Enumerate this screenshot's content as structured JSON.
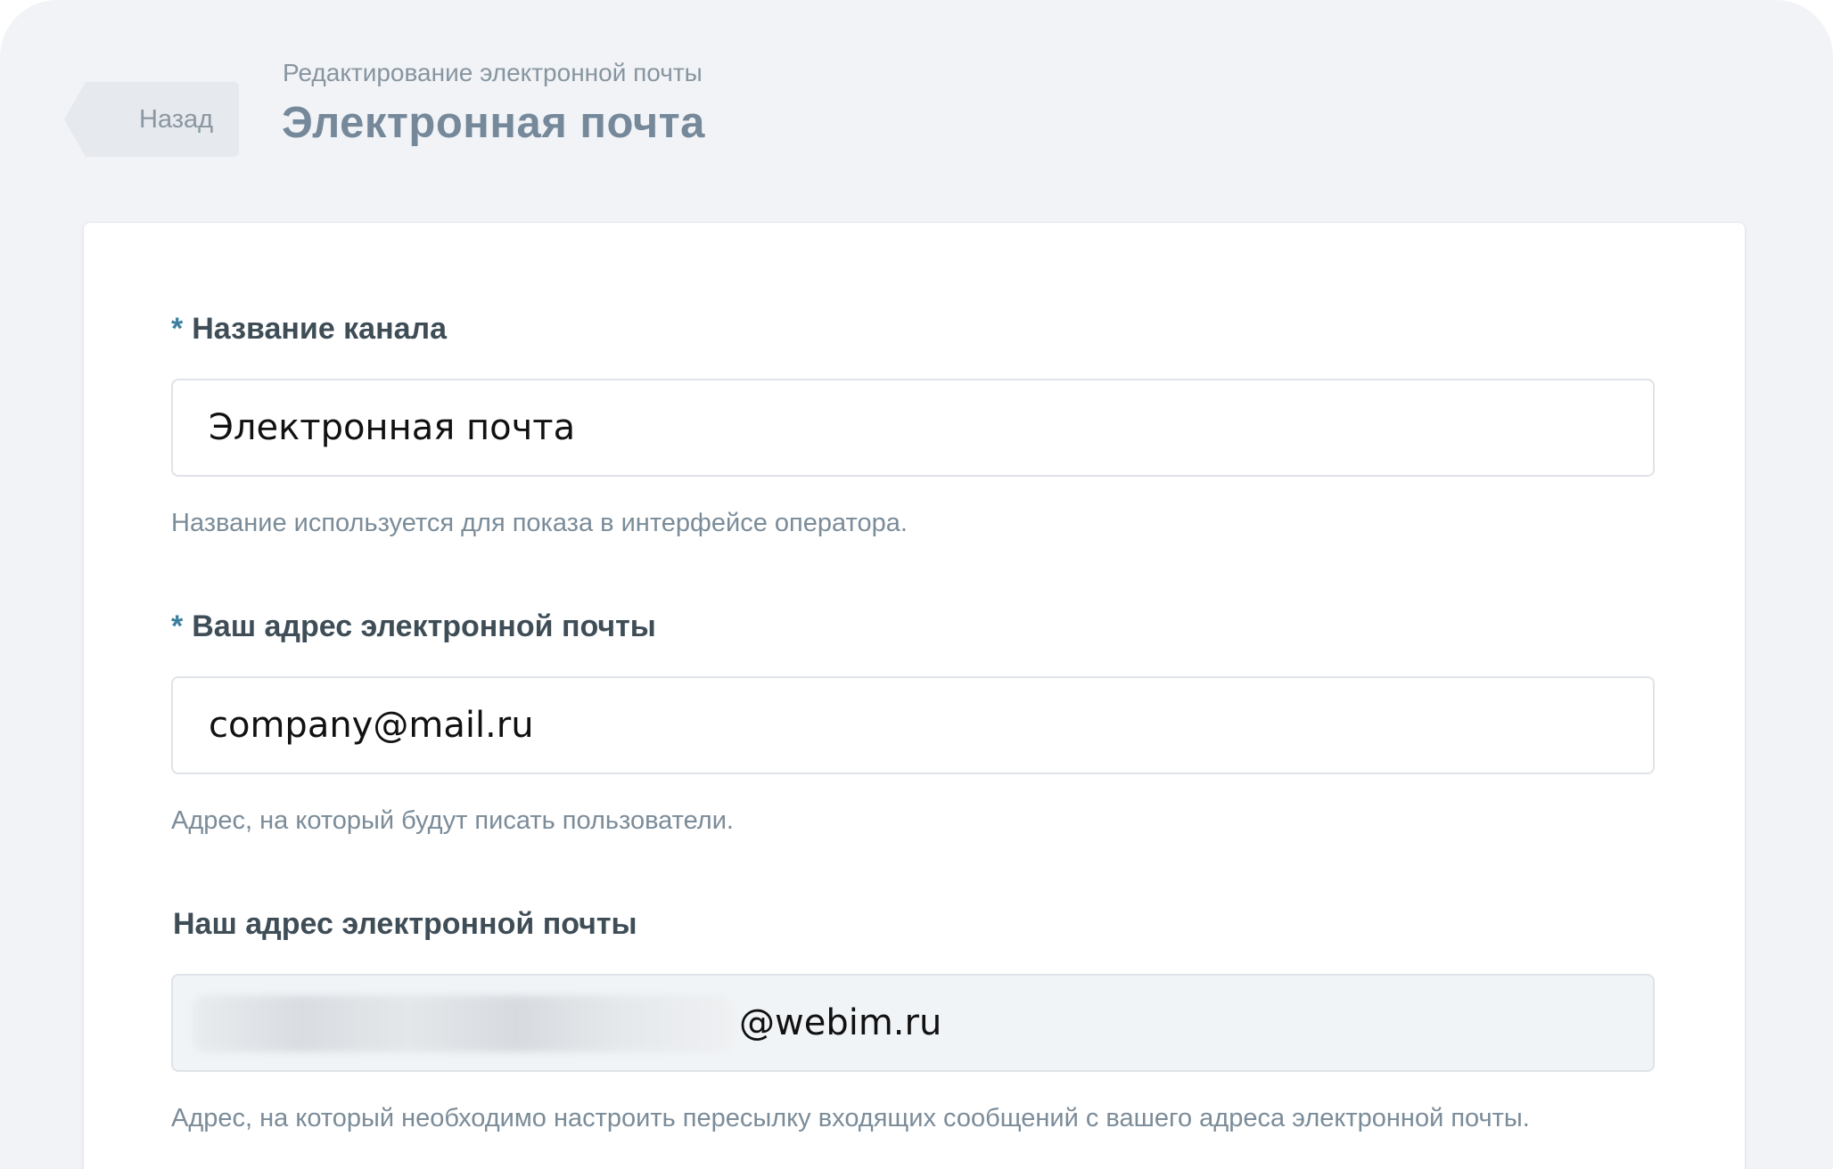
{
  "header": {
    "back_label": "Назад",
    "subtitle": "Редактирование электронной почты",
    "title": "Электронная почта"
  },
  "form": {
    "channel_name": {
      "label": "Название канала",
      "required": "*",
      "value": "Электронная почта",
      "hint": "Название используется для показа в интерфейсе оператора."
    },
    "your_email": {
      "label": "Ваш адрес электронной почты",
      "required": "*",
      "value": "company@mail.ru",
      "hint": "Адрес, на который будут писать пользователи."
    },
    "our_email": {
      "label": "Наш адрес электронной почты",
      "suffix": "@webim.ru",
      "hint": "Адрес, на который необходимо настроить пересылку входящих сообщений с вашего адреса электронной почты."
    }
  }
}
